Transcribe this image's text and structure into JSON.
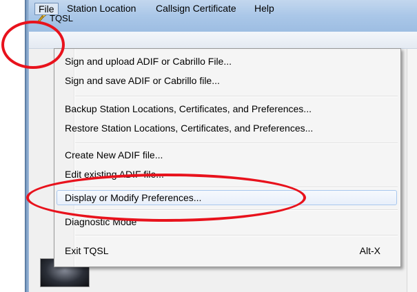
{
  "window": {
    "title": "TQSL"
  },
  "menubar": {
    "file": "File",
    "station_location": "Station Location",
    "callsign_certificate": "Callsign Certificate",
    "help": "Help"
  },
  "file_menu": {
    "items": [
      {
        "label": "Sign and upload ADIF or Cabrillo File...",
        "accel": ""
      },
      {
        "label": "Sign and save ADIF or Cabrillo file...",
        "accel": ""
      },
      {
        "label": "Backup Station Locations, Certificates, and Preferences...",
        "accel": ""
      },
      {
        "label": "Restore Station Locations, Certificates, and Preferences...",
        "accel": ""
      },
      {
        "label": "Create New ADIF file...",
        "accel": ""
      },
      {
        "label": "Edit existing ADIF file...",
        "accel": ""
      },
      {
        "label": "Display or Modify Preferences...",
        "accel": "",
        "highlighted": true
      },
      {
        "label": "Diagnostic Mode",
        "accel": ""
      },
      {
        "label": "Exit TQSL",
        "accel": "Alt-X"
      }
    ]
  },
  "annotations": {
    "color": "#e8121c",
    "circled": [
      "File",
      "Display or Modify Preferences..."
    ]
  }
}
